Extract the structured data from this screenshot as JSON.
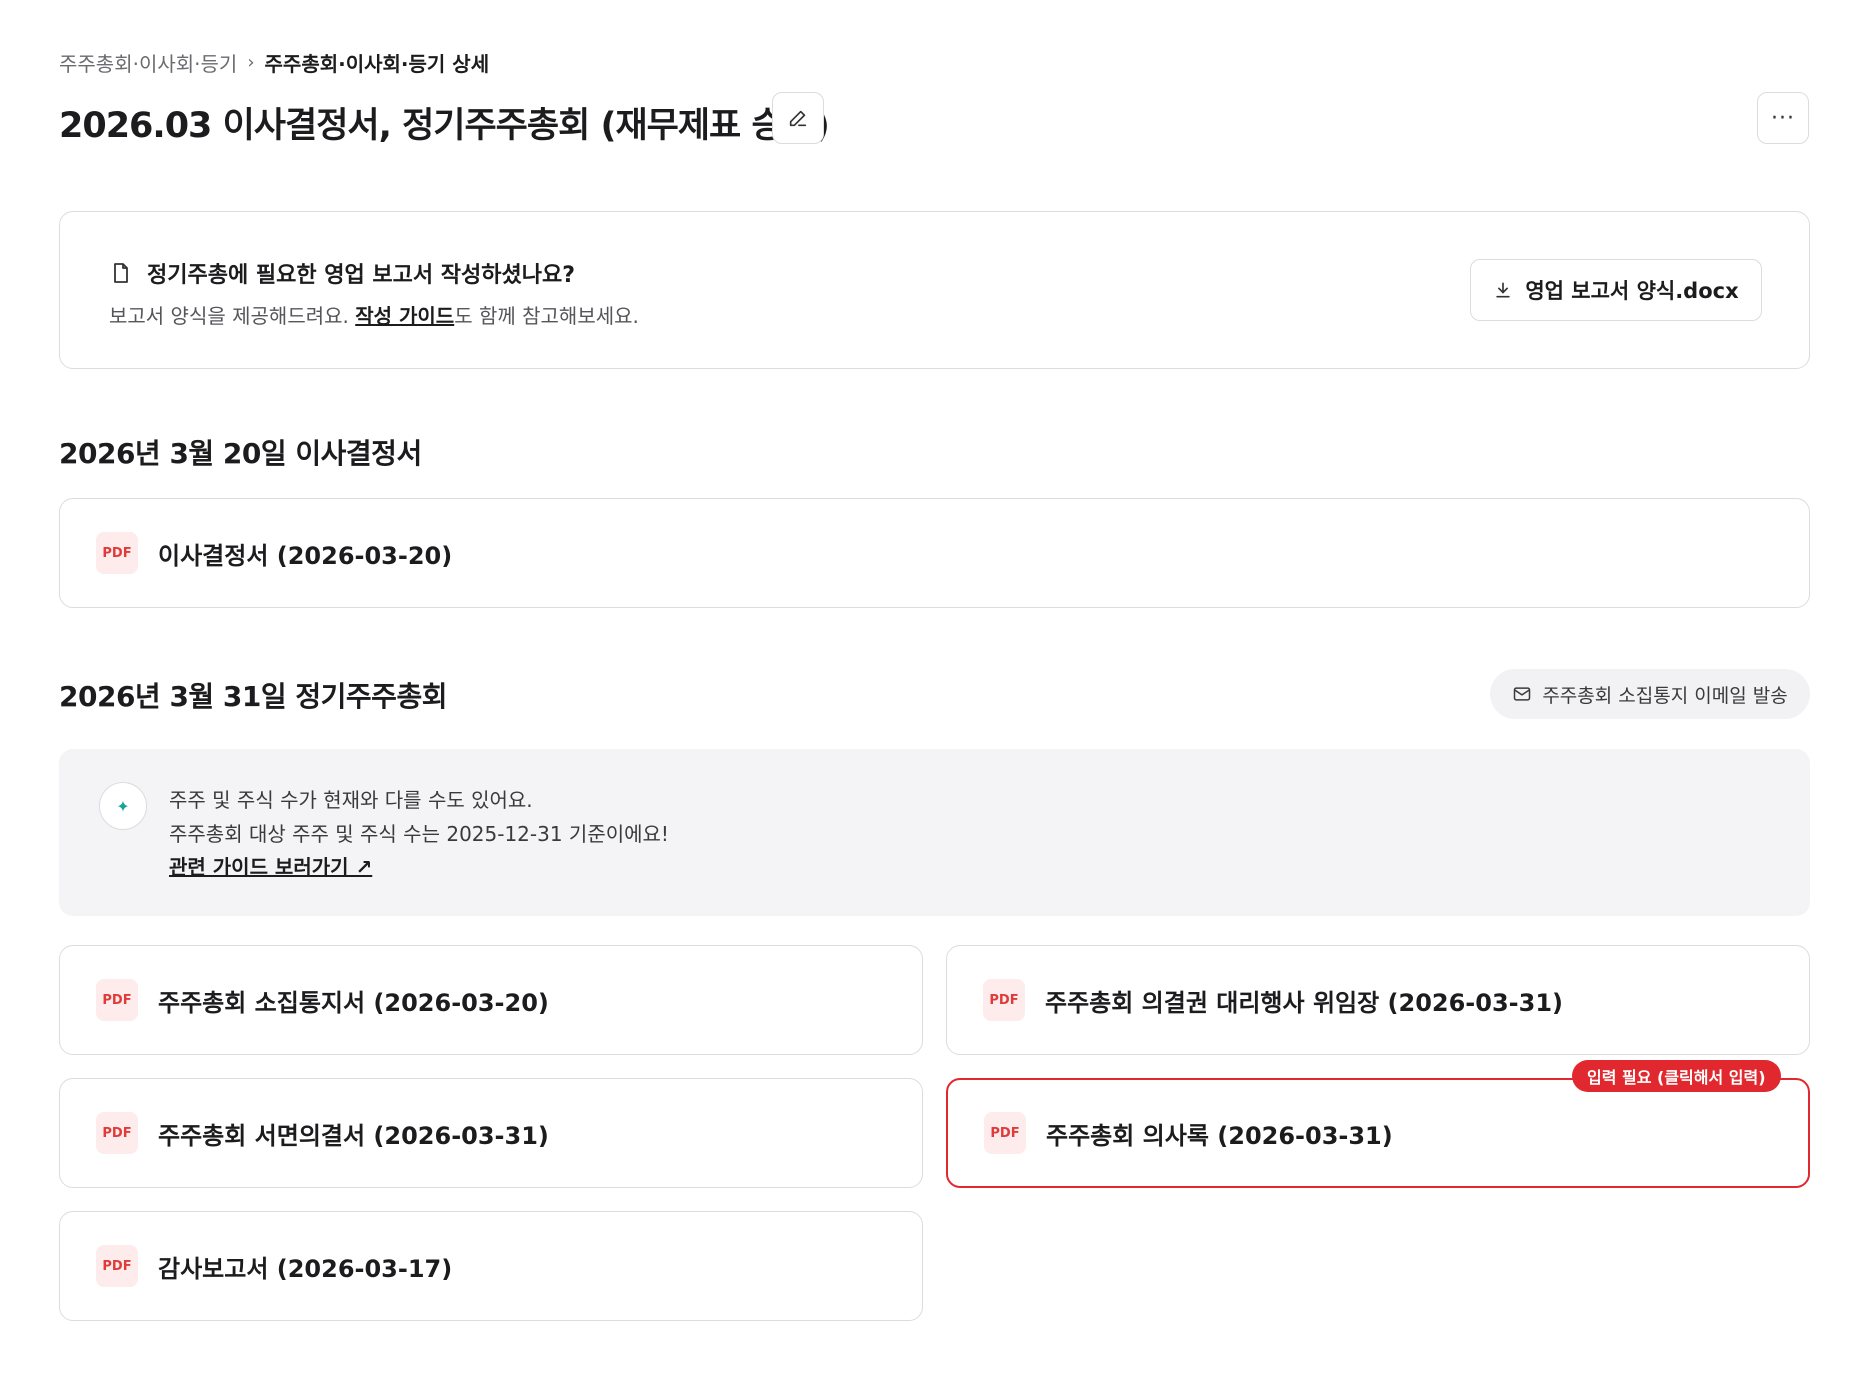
{
  "breadcrumb": {
    "parent": "주주총회·이사회·등기",
    "separator": "›",
    "current": "주주총회·이사회·등기 상세"
  },
  "header": {
    "title": "2026.03 이사결정서, 정기주주총회 (재무제표 승인)",
    "more_label": "···"
  },
  "report_card": {
    "heading": "정기주총에 필요한 영업 보고서 작성하셨나요?",
    "desc_prefix": "보고서 양식을 제공해드려요. ",
    "desc_link": "작성 가이드",
    "desc_suffix": "도 함께 참고해보세요.",
    "download_label": "영업 보고서 양식.docx"
  },
  "section1": {
    "title": "2026년 3월 20일 이사결정서",
    "documents": [
      {
        "label": "이사결정서 (2026-03-20)"
      }
    ]
  },
  "section2": {
    "title": "2026년 3월 31일 정기주주총회",
    "email_button": "주주총회 소집통지 이메일 발송",
    "notice": {
      "line1": "주주 및 주식 수가 현재와 다를 수도 있어요.",
      "line2": "주주총회 대상 주주 및 주식 수는 2025-12-31 기준이에요!",
      "link": "관련 가이드 보러가기 ↗"
    },
    "documents": [
      {
        "label": "주주총회 소집통지서 (2026-03-20)"
      },
      {
        "label": "주주총회 의결권 대리행사 위임장 (2026-03-31)"
      },
      {
        "label": "주주총회 서면의결서 (2026-03-31)"
      },
      {
        "label": "주주총회 의사록 (2026-03-31)"
      },
      {
        "label": "감사보고서 (2026-03-17)"
      }
    ],
    "required_badge": "입력 필요 (클릭해서 입력)"
  },
  "pdf_icon_label": "PDF",
  "colors": {
    "error": "#e0282e",
    "pdf_bg": "#fdeceb",
    "pdf_text": "#e03a3a",
    "notice_bg": "#f4f4f6",
    "accent": "#1aa39a"
  }
}
